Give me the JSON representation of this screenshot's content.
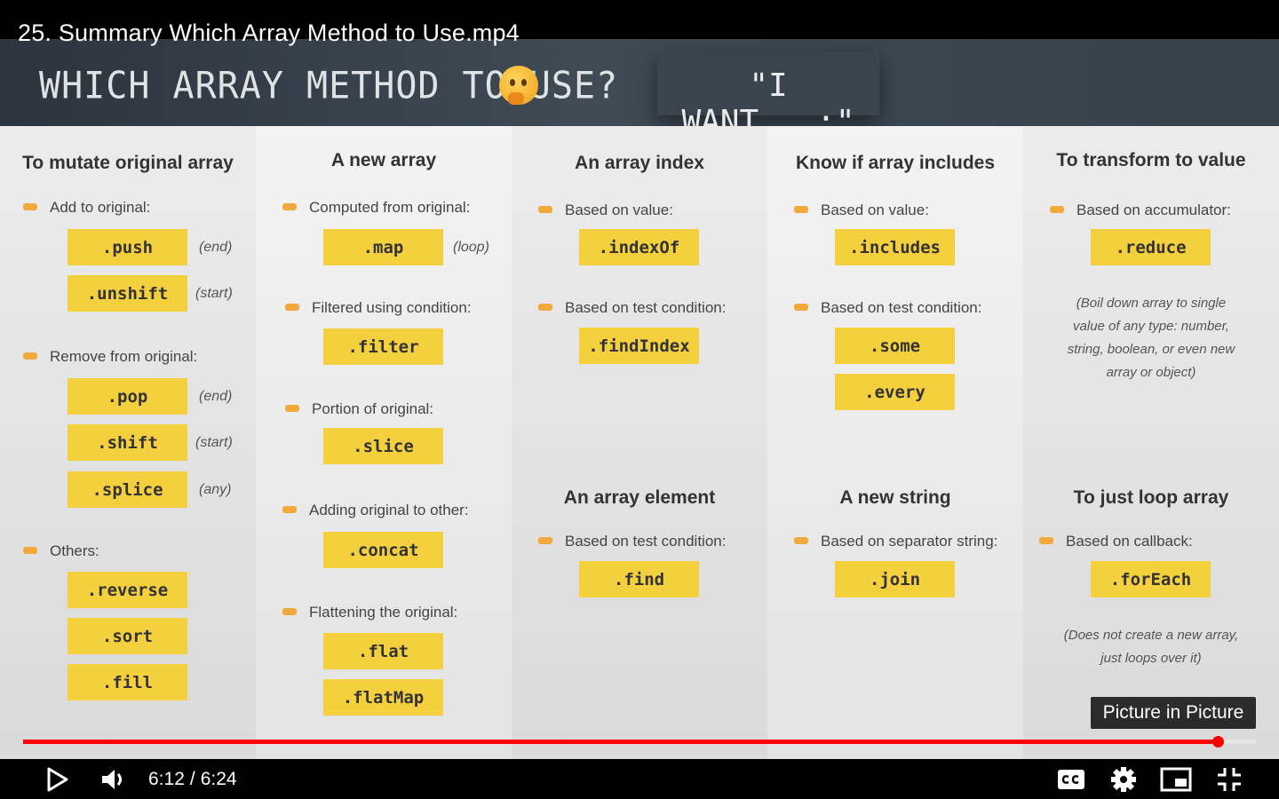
{
  "video": {
    "title": "25. Summary Which Array Method to Use.mp4",
    "current_time": "6:12",
    "separator": "/",
    "duration": "6:24",
    "progress_fraction": 0.969,
    "tooltip": "Picture in Picture"
  },
  "slide": {
    "heading": "WHICH ARRAY METHOD TO USE?",
    "want": "\"I WANT...:\"",
    "columns": [
      {
        "title": "To mutate original array",
        "groups": [
          {
            "label": "Add to original:",
            "methods": [
              {
                "name": ".push",
                "hint": "(end)"
              },
              {
                "name": ".unshift",
                "hint": "(start)"
              }
            ]
          },
          {
            "label": "Remove from original:",
            "methods": [
              {
                "name": ".pop",
                "hint": "(end)"
              },
              {
                "name": ".shift",
                "hint": "(start)"
              },
              {
                "name": ".splice",
                "hint": "(any)"
              }
            ]
          },
          {
            "label": "Others:",
            "methods": [
              {
                "name": ".reverse"
              },
              {
                "name": ".sort"
              },
              {
                "name": ".fill"
              }
            ]
          }
        ]
      },
      {
        "title": "A new array",
        "groups": [
          {
            "label": "Computed from original:",
            "methods": [
              {
                "name": ".map",
                "hint": "(loop)"
              }
            ]
          },
          {
            "label": "Filtered using condition:",
            "methods": [
              {
                "name": ".filter"
              }
            ]
          },
          {
            "label": "Portion of original:",
            "methods": [
              {
                "name": ".slice"
              }
            ]
          },
          {
            "label": "Adding original to other:",
            "methods": [
              {
                "name": ".concat"
              }
            ]
          },
          {
            "label": "Flattening the original:",
            "methods": [
              {
                "name": ".flat"
              },
              {
                "name": ".flatMap"
              }
            ]
          }
        ]
      },
      {
        "title": "An array index",
        "groups": [
          {
            "label": "Based on value:",
            "methods": [
              {
                "name": ".indexOf"
              }
            ]
          },
          {
            "label": "Based on test condition:",
            "methods": [
              {
                "name": ".findIndex"
              }
            ]
          }
        ],
        "title2": "An array element",
        "groups2": [
          {
            "label": "Based on test condition:",
            "methods": [
              {
                "name": ".find"
              }
            ]
          }
        ]
      },
      {
        "title": "Know if array includes",
        "groups": [
          {
            "label": "Based on value:",
            "methods": [
              {
                "name": ".includes"
              }
            ]
          },
          {
            "label": "Based on test condition:",
            "methods": [
              {
                "name": ".some"
              },
              {
                "name": ".every"
              }
            ]
          }
        ],
        "title2": "A new string",
        "groups2": [
          {
            "label": "Based on separator string:",
            "methods": [
              {
                "name": ".join"
              }
            ]
          }
        ]
      },
      {
        "title": "To transform to value",
        "groups": [
          {
            "label": "Based on accumulator:",
            "methods": [
              {
                "name": ".reduce"
              }
            ]
          }
        ],
        "note": [
          "(Boil down array to single",
          "value of any type: number,",
          "string, boolean, or even new",
          "array or object)"
        ],
        "title2": "To just loop array",
        "groups2": [
          {
            "label": "Based on callback:",
            "methods": [
              {
                "name": ".forEach"
              }
            ]
          }
        ],
        "note2": [
          "(Does not create a new array,",
          "just loops over it)"
        ]
      }
    ]
  },
  "icons": {
    "play": "play-icon",
    "volume": "volume-icon",
    "captions": "captions-icon",
    "settings": "gear-icon",
    "miniplayer": "miniplayer-icon",
    "exit_fullscreen": "exit-fullscreen-icon",
    "bullet": "pointing-hand-icon",
    "thinking": "thinking-face-icon"
  },
  "colors": {
    "chip": "#f4d03f",
    "progress": "#ff0000",
    "header": "#36414b"
  }
}
